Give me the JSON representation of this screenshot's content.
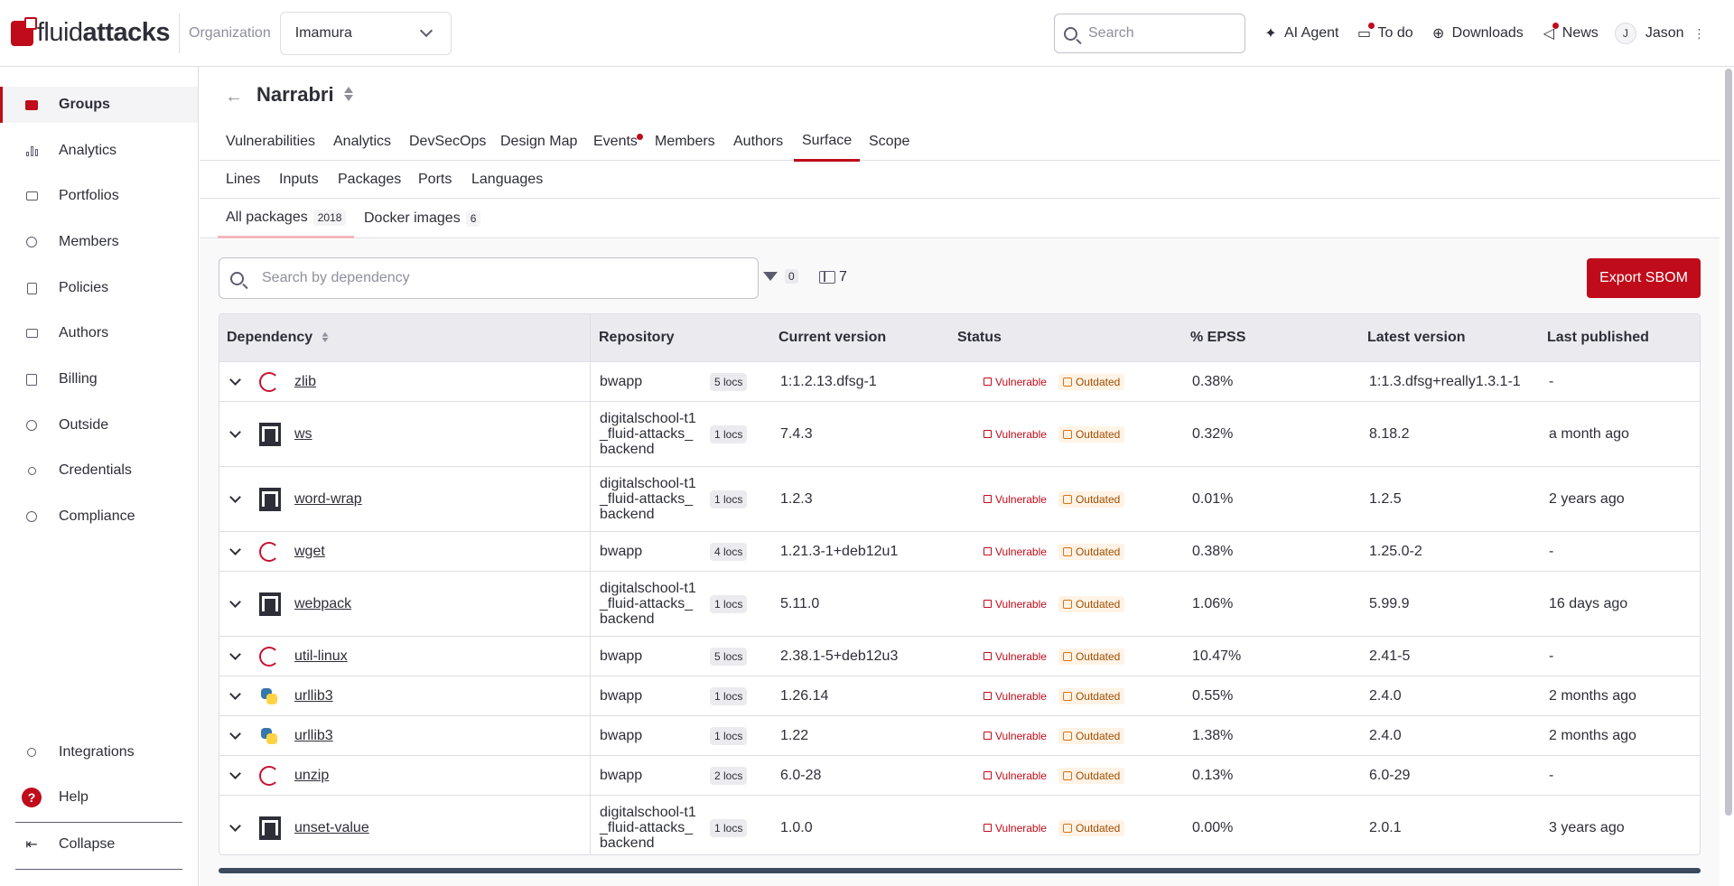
{
  "brand": {
    "light": "fluid",
    "bold": "attacks"
  },
  "topbar": {
    "org_label": "Organization",
    "org_value": "Imamura",
    "search_placeholder": "Search",
    "ai_agent": "AI Agent",
    "todo": "To do",
    "downloads": "Downloads",
    "news": "News",
    "user_initial": "J",
    "user_name": "Jason"
  },
  "sidebar": {
    "items": [
      {
        "label": "Groups"
      },
      {
        "label": "Analytics"
      },
      {
        "label": "Portfolios"
      },
      {
        "label": "Members"
      },
      {
        "label": "Policies"
      },
      {
        "label": "Authors"
      },
      {
        "label": "Billing"
      },
      {
        "label": "Outside"
      },
      {
        "label": "Credentials"
      },
      {
        "label": "Compliance"
      }
    ],
    "integrations": "Integrations",
    "help": "Help",
    "collapse": "Collapse"
  },
  "group": {
    "title": "Narrabri"
  },
  "tabs_main": [
    "Vulnerabilities",
    "Analytics",
    "DevSecOps",
    "Design Map",
    "Events",
    "Members",
    "Authors",
    "Surface",
    "Scope"
  ],
  "tabs_surface": [
    "Lines",
    "Inputs",
    "Packages",
    "Ports",
    "Languages"
  ],
  "tabs_packages": [
    {
      "label": "All packages",
      "count": "2018"
    },
    {
      "label": "Docker images",
      "count": "6"
    }
  ],
  "toolbar": {
    "search_placeholder": "Search by dependency",
    "filter_count": "0",
    "columns_count": "7",
    "export_label": "Export SBOM"
  },
  "table": {
    "headers": [
      "Dependency",
      "Repository",
      "Current version",
      "Status",
      "% EPSS",
      "Latest version",
      "Last published"
    ],
    "status_vulnerable": "Vulnerable",
    "status_outdated": "Outdated",
    "rows": [
      {
        "icon": "debian-icon",
        "name": "zlib",
        "repo": "bwapp",
        "locs": "5 locs",
        "current": "1:1.2.13.dfsg-1",
        "epss": "0.38%",
        "latest": "1:1.3.dfsg+really1.3.1-1",
        "published": "-"
      },
      {
        "icon": "npm-icon",
        "name": "ws",
        "repo": "digitalschool-t1_fluid-attacks_backend",
        "locs": "1 locs",
        "current": "7.4.3",
        "epss": "0.32%",
        "latest": "8.18.2",
        "published": "a month ago"
      },
      {
        "icon": "npm-icon",
        "name": "word-wrap",
        "repo": "digitalschool-t1_fluid-attacks_backend",
        "locs": "1 locs",
        "current": "1.2.3",
        "epss": "0.01%",
        "latest": "1.2.5",
        "published": "2 years ago"
      },
      {
        "icon": "debian-icon",
        "name": "wget",
        "repo": "bwapp",
        "locs": "4 locs",
        "current": "1.21.3-1+deb12u1",
        "epss": "0.38%",
        "latest": "1.25.0-2",
        "published": "-"
      },
      {
        "icon": "npm-icon",
        "name": "webpack",
        "repo": "digitalschool-t1_fluid-attacks_backend",
        "locs": "1 locs",
        "current": "5.11.0",
        "epss": "1.06%",
        "latest": "5.99.9",
        "published": "16 days ago"
      },
      {
        "icon": "debian-icon",
        "name": "util-linux",
        "repo": "bwapp",
        "locs": "5 locs",
        "current": "2.38.1-5+deb12u3",
        "epss": "10.47%",
        "latest": "2.41-5",
        "published": "-"
      },
      {
        "icon": "python-icon",
        "name": "urllib3",
        "repo": "bwapp",
        "locs": "1 locs",
        "current": "1.26.14",
        "epss": "0.55%",
        "latest": "2.4.0",
        "published": "2 months ago"
      },
      {
        "icon": "python-icon",
        "name": "urllib3",
        "repo": "bwapp",
        "locs": "1 locs",
        "current": "1.22",
        "epss": "1.38%",
        "latest": "2.4.0",
        "published": "2 months ago"
      },
      {
        "icon": "debian-icon",
        "name": "unzip",
        "repo": "bwapp",
        "locs": "2 locs",
        "current": "6.0-28",
        "epss": "0.13%",
        "latest": "6.0-29",
        "published": "-"
      },
      {
        "icon": "npm-icon",
        "name": "unset-value",
        "repo": "digitalschool-t1_fluid-attacks_backend",
        "locs": "1 locs",
        "current": "1.0.0",
        "epss": "0.00%",
        "latest": "2.0.1",
        "published": "3 years ago"
      }
    ]
  }
}
